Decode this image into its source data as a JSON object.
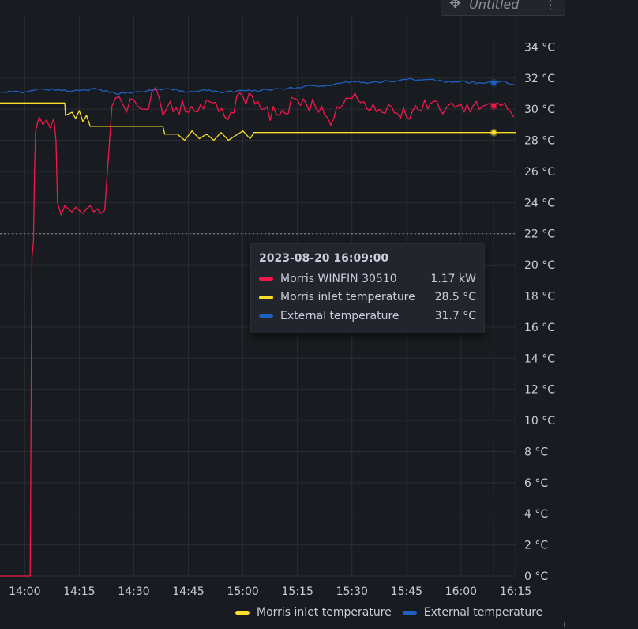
{
  "panel": {
    "title": "Untitled",
    "move_icon": "move-icon",
    "menu_icon": "more-vertical-icon"
  },
  "tooltip": {
    "time": "2023-08-20 16:09:00",
    "rows": [
      {
        "name": "Morris WINFIN 30510",
        "value": "1.17 kW",
        "color": "#f2194a"
      },
      {
        "name": "Morris inlet temperature",
        "value": "28.5 °C",
        "color": "#fade2a"
      },
      {
        "name": "External temperature",
        "value": "31.7 °C",
        "color": "#1f60c4"
      }
    ]
  },
  "legend": {
    "items": [
      {
        "label": "Morris inlet temperature",
        "color": "#fade2a"
      },
      {
        "label": "External temperature",
        "color": "#1f60c4"
      }
    ]
  },
  "chart_data": {
    "type": "line",
    "ylim": [
      0,
      36
    ],
    "y_ticks": [
      "0 °C",
      "2 °C",
      "4 °C",
      "6 °C",
      "8 °C",
      "10 °C",
      "12 °C",
      "14 °C",
      "16 °C",
      "18 °C",
      "20 °C",
      "22 °C",
      "24 °C",
      "26 °C",
      "28 °C",
      "30 °C",
      "32 °C",
      "34 °C"
    ],
    "y_tick_values": [
      0,
      2,
      4,
      6,
      8,
      10,
      12,
      14,
      16,
      18,
      20,
      22,
      24,
      26,
      28,
      30,
      32,
      34
    ],
    "x_ticks": [
      "14:00",
      "14:15",
      "14:30",
      "14:45",
      "15:00",
      "15:15",
      "15:30",
      "15:45",
      "16:00",
      "16:15"
    ],
    "x_tick_minutes": [
      0,
      15,
      30,
      45,
      60,
      75,
      90,
      105,
      120,
      135
    ],
    "x_range_minutes": [
      -6.8,
      135
    ],
    "crosshair": {
      "x_minutes": 129,
      "y": 22
    },
    "series": [
      {
        "name": "Morris WINFIN 30510",
        "color": "#f2194a",
        "x": [
          -6.8,
          1.5,
          2.0,
          2.4,
          2.7,
          3.0,
          3.6,
          4.0,
          5.0,
          6.0,
          7.0,
          8.0,
          8.6,
          9.0,
          10.0,
          11.0,
          12.0,
          13.0,
          14.0,
          15.0,
          16.0,
          17.0,
          18.0,
          19.0,
          20.0,
          21.0,
          22.0,
          24.0,
          26.0,
          28.0,
          30.0,
          33.0,
          36.0,
          38.0,
          40.0,
          45.0,
          50.0,
          55.0,
          60.0,
          65.0,
          70.0,
          75.0,
          80.0,
          85.0,
          90.0,
          95.0,
          100.0,
          105.0,
          110.0,
          115.0,
          120.0,
          125.0,
          129.0,
          132.0,
          134.5
        ],
        "y": [
          0.0,
          0.0,
          20.5,
          21.5,
          26.0,
          28.6,
          29.2,
          29.5,
          29.0,
          29.3,
          28.8,
          29.4,
          28.0,
          24.0,
          23.2,
          23.8,
          23.6,
          23.4,
          23.7,
          23.5,
          23.3,
          23.6,
          23.8,
          23.4,
          23.6,
          23.3,
          23.5,
          30.2,
          30.8,
          29.8,
          30.6,
          30.0,
          31.4,
          29.6,
          30.5,
          29.8,
          30.6,
          29.5,
          30.8,
          30.0,
          29.6,
          30.6,
          30.1,
          29.4,
          30.7,
          29.9,
          30.3,
          29.5,
          30.6,
          29.7,
          30.3,
          30.0,
          30.2,
          30.4,
          29.5
        ]
      },
      {
        "name": "Morris inlet temperature",
        "color": "#fade2a",
        "x": [
          -6.8,
          11.0,
          11.2,
          13.0,
          14.0,
          15.0,
          16.0,
          17.0,
          18.0,
          19.0,
          20.0,
          25.0,
          30.0,
          35.0,
          38.0,
          38.5,
          42.0,
          44.0,
          46.0,
          48.0,
          50.0,
          52.0,
          54.0,
          56.0,
          58.0,
          60.0,
          62.0,
          63.0,
          70.0,
          90.0,
          110.0,
          129.0,
          135.0
        ],
        "y": [
          30.4,
          30.4,
          29.6,
          29.8,
          29.4,
          29.9,
          29.2,
          29.6,
          28.9,
          28.9,
          28.9,
          28.9,
          28.9,
          28.9,
          28.9,
          28.4,
          28.4,
          28.0,
          28.6,
          28.1,
          28.4,
          28.0,
          28.5,
          28.0,
          28.3,
          28.6,
          28.1,
          28.5,
          28.5,
          28.5,
          28.5,
          28.5,
          28.5
        ]
      },
      {
        "name": "External temperature",
        "color": "#1f60c4",
        "x": [
          -6.8,
          0.0,
          5.0,
          10.0,
          15.0,
          20.0,
          25.0,
          30.0,
          35.0,
          40.0,
          45.0,
          50.0,
          55.0,
          60.0,
          65.0,
          70.0,
          75.0,
          80.0,
          85.0,
          90.0,
          95.0,
          100.0,
          105.0,
          110.0,
          115.0,
          120.0,
          125.0,
          129.0,
          132.0,
          134.5
        ],
        "y": [
          31.1,
          31.1,
          31.3,
          31.2,
          31.2,
          31.3,
          31.0,
          31.1,
          31.2,
          31.3,
          31.1,
          31.2,
          31.1,
          31.2,
          31.2,
          31.3,
          31.4,
          31.5,
          31.6,
          31.8,
          31.7,
          31.8,
          31.9,
          31.9,
          31.8,
          31.8,
          31.7,
          31.7,
          31.8,
          31.6
        ]
      }
    ]
  }
}
